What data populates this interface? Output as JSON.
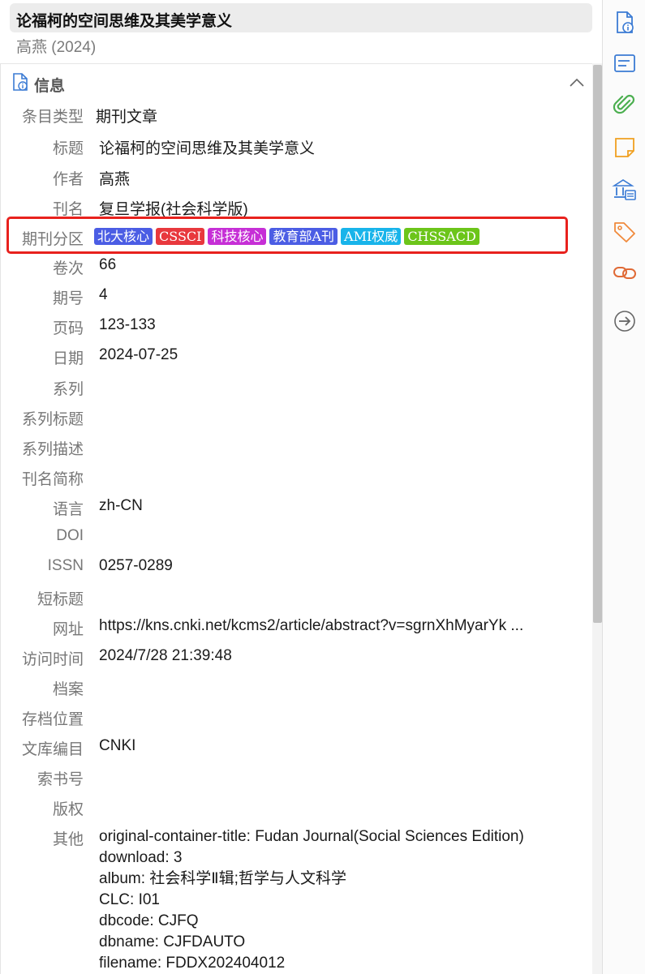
{
  "header": {
    "title": "论福柯的空间思维及其美学意义",
    "byline": "高燕 (2024)"
  },
  "section": {
    "title": "信息"
  },
  "fields": [
    {
      "label": "条目类型",
      "value": "期刊文章"
    },
    {
      "label": "标题",
      "value": "论福柯的空间思维及其美学意义"
    },
    {
      "label": "作者",
      "value": "高燕"
    },
    {
      "label": "刊名",
      "value": "复旦学报(社会科学版)"
    },
    {
      "label": "期刊分区",
      "value": ""
    },
    {
      "label": "卷次",
      "value": "66"
    },
    {
      "label": "期号",
      "value": "4"
    },
    {
      "label": "页码",
      "value": "123-133"
    },
    {
      "label": "日期",
      "value": "2024-07-25"
    },
    {
      "label": "系列",
      "value": ""
    },
    {
      "label": "系列标题",
      "value": ""
    },
    {
      "label": "系列描述",
      "value": ""
    },
    {
      "label": "刊名简称",
      "value": ""
    },
    {
      "label": "语言",
      "value": "zh-CN"
    },
    {
      "label": "DOI",
      "value": ""
    },
    {
      "label": "ISSN",
      "value": "0257-0289"
    },
    {
      "label": "短标题",
      "value": ""
    },
    {
      "label": "网址",
      "value": "https://kns.cnki.net/kcms2/article/abstract?v=sgrnXhMyarYk ..."
    },
    {
      "label": "访问时间",
      "value": "2024/7/28 21:39:48"
    },
    {
      "label": "档案",
      "value": ""
    },
    {
      "label": "存档位置",
      "value": ""
    },
    {
      "label": "文库编目",
      "value": "CNKI"
    },
    {
      "label": "索书号",
      "value": ""
    },
    {
      "label": "版权",
      "value": ""
    },
    {
      "label": "其他",
      "value": ""
    }
  ],
  "tags": [
    {
      "text": "北大核心",
      "color": "#4b5de4"
    },
    {
      "text": "CSSCI",
      "color": "#e8383d"
    },
    {
      "text": "科技核心",
      "color": "#c62fd6"
    },
    {
      "text": "教育部A刊",
      "color": "#4b5de4"
    },
    {
      "text": "AMI权威",
      "color": "#18b4ea"
    },
    {
      "text": "CHSSACD",
      "color": "#6cc51a"
    }
  ],
  "others_lines": [
    "original-container-title: Fudan Journal(Social Sciences Edition)",
    "download: 3",
    "album: 社会科学Ⅱ辑;哲学与人文科学",
    "CLC: I01",
    "dbcode: CJFQ",
    "dbname: CJFDAUTO",
    "filename: FDDX202404012"
  ],
  "sidenav": [
    "info-icon",
    "abstract-icon",
    "attachments-icon",
    "notes-icon",
    "libraries-icon",
    "tags-icon",
    "related-icon",
    "locate-icon"
  ],
  "colors": {
    "accent": "#3b7bd4",
    "green": "#4caf50",
    "orange": "#f0a020",
    "tag_orange": "#f08a3c",
    "highlight": "#e8211d"
  }
}
